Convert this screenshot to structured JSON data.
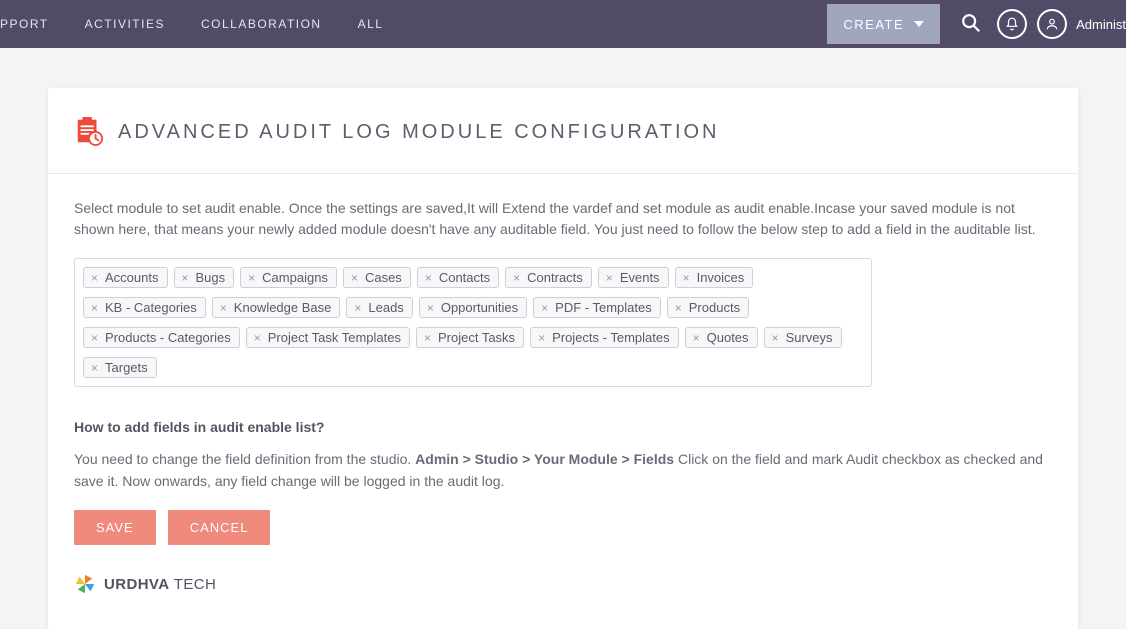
{
  "nav": {
    "items": [
      "PPORT",
      "ACTIVITIES",
      "COLLABORATION",
      "ALL"
    ]
  },
  "create_label": "CREATE",
  "user_label": "Administ",
  "page": {
    "title": "ADVANCED AUDIT LOG MODULE CONFIGURATION",
    "description": "Select module to set audit enable. Once the settings are saved,It will Extend the vardef and set module as audit enable.Incase your saved module is not shown here, that means your newly added module doesn't have any auditable field. You just need to follow the below step to add a field in the auditable list.",
    "modules": [
      "Accounts",
      "Bugs",
      "Campaigns",
      "Cases",
      "Contacts",
      "Contracts",
      "Events",
      "Invoices",
      "KB - Categories",
      "Knowledge Base",
      "Leads",
      "Opportunities",
      "PDF - Templates",
      "Products",
      "Products - Categories",
      "Project Task Templates",
      "Project Tasks",
      "Projects - Templates",
      "Quotes",
      "Surveys",
      "Targets"
    ],
    "howto_title": "How to add fields in audit enable list?",
    "howto_pre": "You need to change the field definition from the studio. ",
    "howto_bold": "Admin > Studio > Your Module > Fields",
    "howto_post": " Click on the field and mark Audit checkbox as checked and save it. Now onwards, any field change will be logged in the audit log.",
    "save_label": "SAVE",
    "cancel_label": "CANCEL",
    "brand_bold": "URDHVA",
    "brand_light": " TECH"
  }
}
